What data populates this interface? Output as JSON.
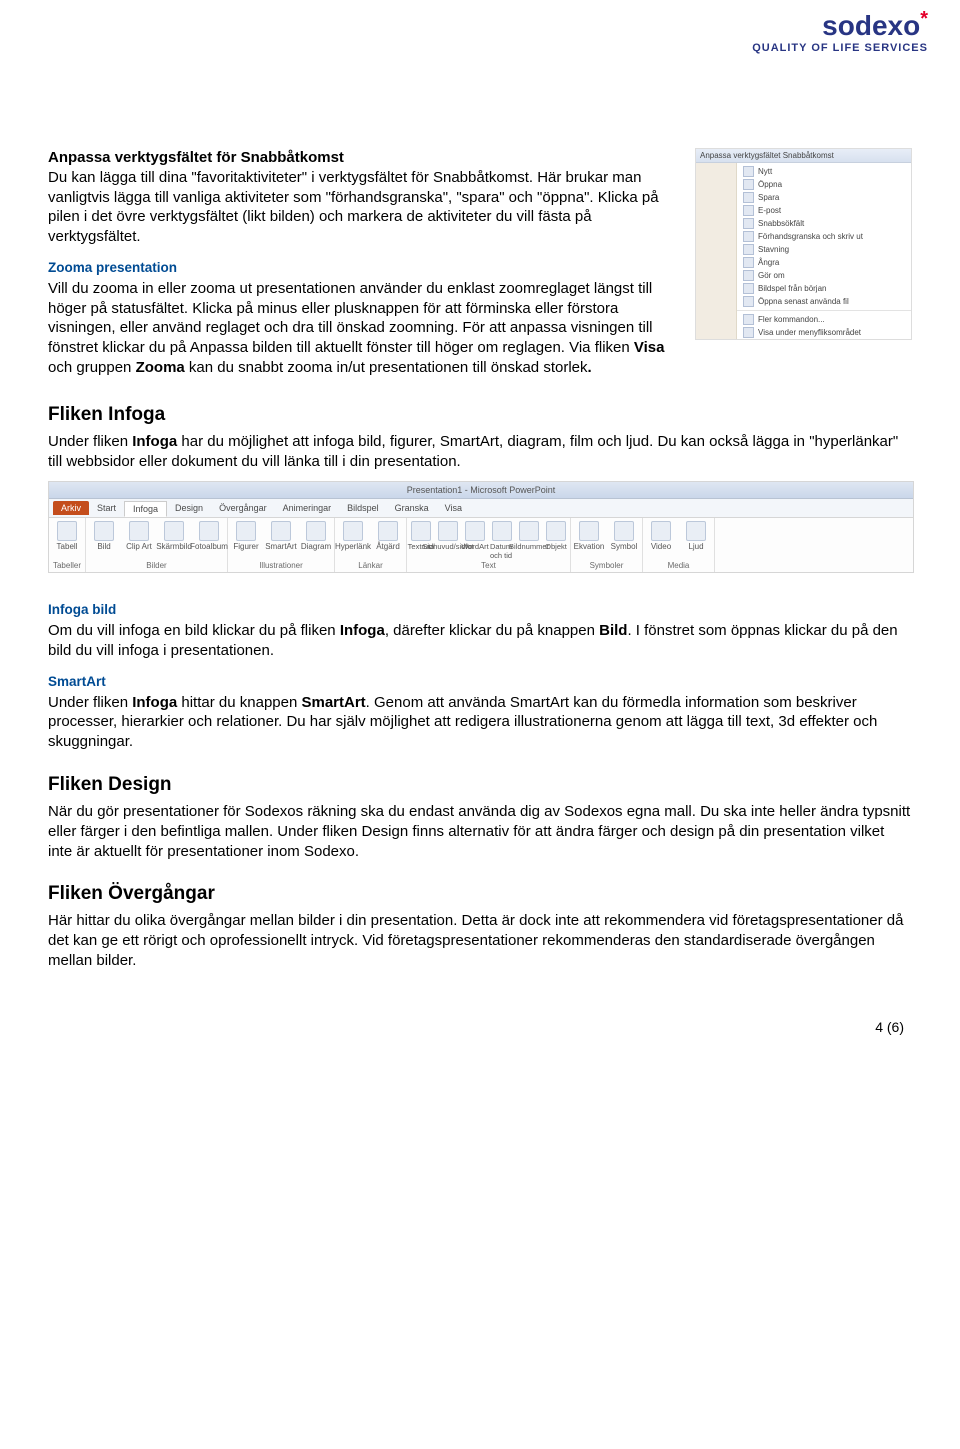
{
  "logo": {
    "name": "sodexo",
    "tagline": "QUALITY OF LIFE SERVICES"
  },
  "topsection": {
    "heading": "Anpassa verktygsfältet för Snabbåtkomst",
    "para": "Du kan lägga till dina \"favoritaktiviteter\" i verktygsfältet för Snabbåtkomst. Här brukar man vanligtvis lägga till vanliga aktiviteter som \"förhandsgranska\", \"spara\" och \"öppna\". Klicka på pilen i det övre verktygsfältet (likt bilden) och markera de aktiviteter du vill fästa på verktygsfältet."
  },
  "zoom": {
    "heading": "Zooma presentation",
    "para": "Vill du zooma in eller zooma ut presentationen använder du enklast zoomreglaget längst till höger på statusfältet. Klicka på minus eller plusknappen för att förminska eller förstora visningen, eller använd reglaget och dra till önskad zoomning. För att anpassa visningen till fönstret klickar du på Anpassa bilden till aktuellt fönster till höger om reglagen. Via fliken Visa och gruppen Zooma kan du snabbt zooma in/ut presentationen till önskad storlek."
  },
  "infoga": {
    "heading": "Fliken Infoga",
    "para": "Under fliken Infoga har du möjlighet att infoga bild, figurer, SmartArt, diagram, film och ljud. Du kan också lägga in \"hyperlänkar\" till webbsidor eller dokument du vill länka till i din presentation."
  },
  "ribbon": {
    "title": "Presentation1 - Microsoft PowerPoint",
    "tabs": [
      "Arkiv",
      "Start",
      "Infoga",
      "Design",
      "Övergångar",
      "Animeringar",
      "Bildspel",
      "Granska",
      "Visa"
    ],
    "groups": [
      {
        "label": "Tabeller",
        "items": [
          "Tabell"
        ]
      },
      {
        "label": "Bilder",
        "items": [
          "Bild",
          "Clip Art",
          "Skärmbild",
          "Fotoalbum"
        ]
      },
      {
        "label": "Illustrationer",
        "items": [
          "Figurer",
          "SmartArt",
          "Diagram"
        ]
      },
      {
        "label": "Länkar",
        "items": [
          "Hyperlänk",
          "Åtgärd"
        ]
      },
      {
        "label": "Text",
        "items": [
          "Textruta",
          "Sidhuvud/sidfot",
          "WordArt",
          "Datum och tid",
          "Bildnummer",
          "Objekt"
        ]
      },
      {
        "label": "Symboler",
        "items": [
          "Ekvation",
          "Symbol"
        ]
      },
      {
        "label": "Media",
        "items": [
          "Video",
          "Ljud"
        ]
      }
    ]
  },
  "infogabild": {
    "heading": "Infoga bild",
    "para": "Om du vill infoga en bild klickar du på fliken Infoga, därefter klickar du på knappen Bild. I fönstret som öppnas klickar du på den bild du vill infoga i presentationen."
  },
  "smartart": {
    "heading": "SmartArt",
    "para": "Under fliken Infoga hittar du knappen SmartArt. Genom att använda SmartArt kan du förmedla information som beskriver processer, hierarkier och relationer. Du har själv möjlighet att redigera illustrationerna genom att lägga till text, 3d effekter och skuggningar."
  },
  "design": {
    "heading": "Fliken Design",
    "para": "När du gör presentationer för Sodexos räkning ska du endast använda dig av Sodexos egna mall. Du ska inte heller ändra typsnitt eller färger i den befintliga mallen. Under fliken Design finns alternativ för att ändra färger och design på din presentation vilket inte är aktuellt för presentationer inom Sodexo."
  },
  "overgangar": {
    "heading": "Fliken Övergångar",
    "para": "Här hittar du olika övergångar mellan bilder i din presentation. Detta är dock inte att rekommendera vid företagspresentationer då det kan ge ett rörigt och oprofessionellt intryck. Vid företagspresentationer rekommenderas den standardiserade övergången mellan bilder."
  },
  "dropdown_items": [
    "Nytt",
    "Öppna",
    "Spara",
    "E-post",
    "Snabbsökfält",
    "Förhandsgranska och skriv ut",
    "Stavning",
    "Ångra",
    "Gör om",
    "Bildspel från början",
    "Öppna senast använda fil",
    "Fler kommandon...",
    "Visa under menyfliksområdet"
  ],
  "dropdown_title": "Anpassa verktygsfältet Snabbåtkomst",
  "page_number": "4 (6)"
}
